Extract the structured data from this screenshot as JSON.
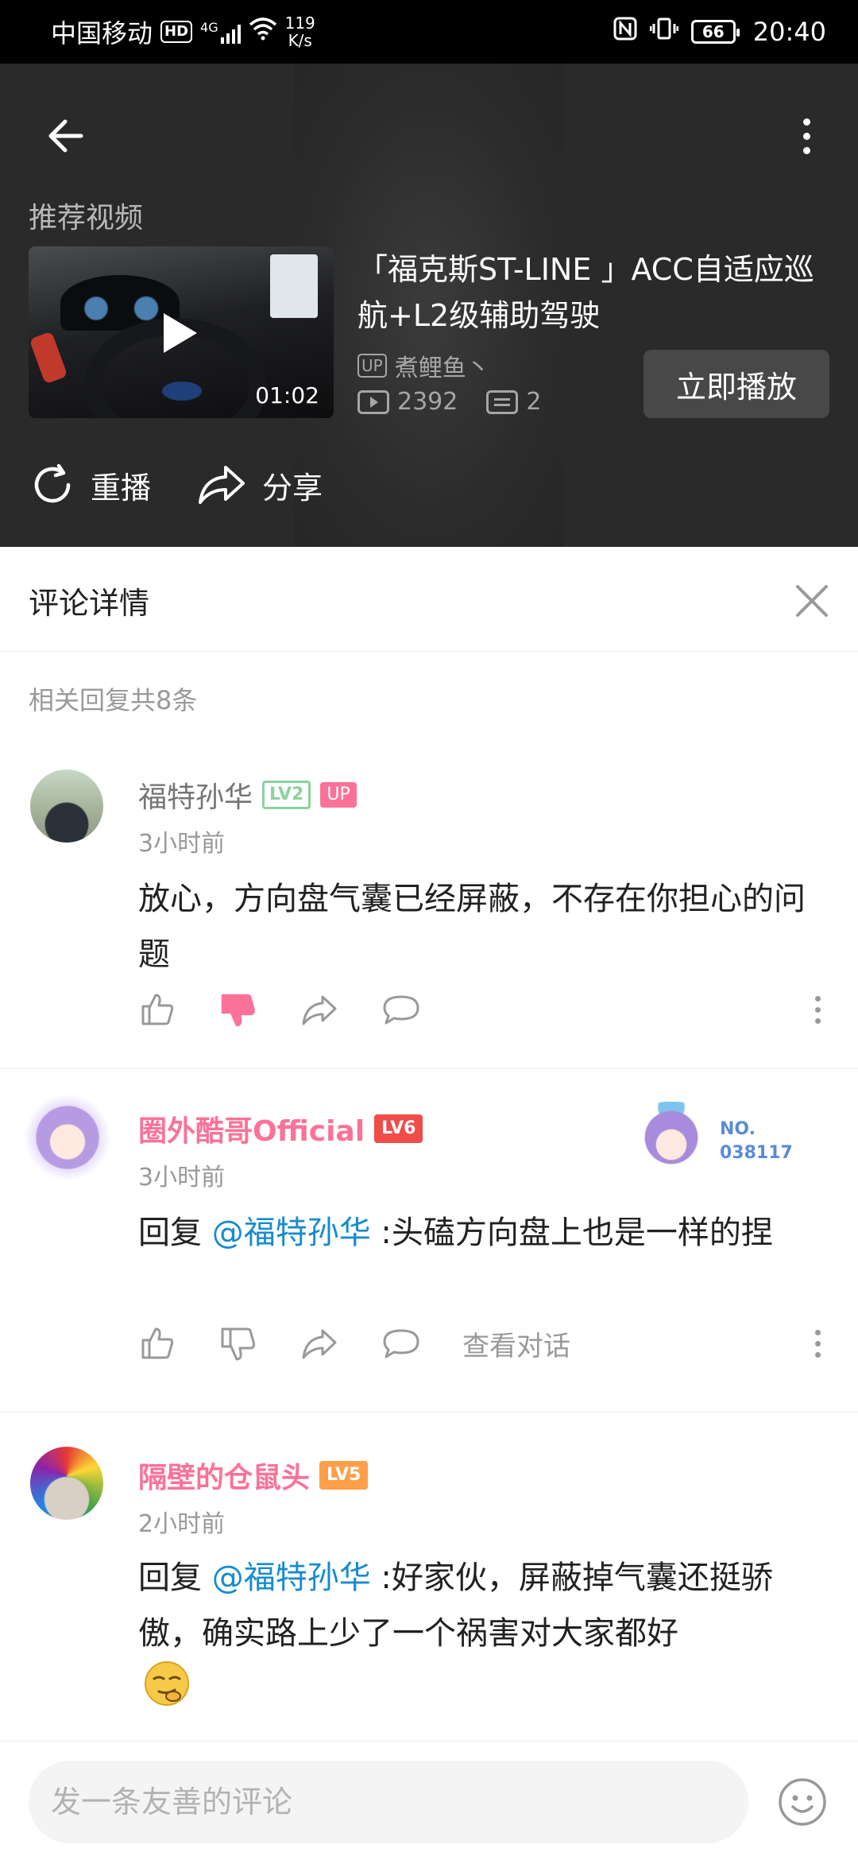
{
  "status_bar": {
    "carrier": "中国移动",
    "hd": "HD",
    "network": "4G",
    "speed_value": "119",
    "speed_unit": "K/s",
    "battery": "66",
    "time": "20:40"
  },
  "video": {
    "section_label": "推荐视频",
    "duration": "01:02",
    "title": "「福克斯ST-LINE 」ACC自适应巡航+L2级辅助驾驶",
    "up_tag": "UP",
    "uploader": "煮鲤鱼丶",
    "views": "2392",
    "comments": "2",
    "play_now": "立即播放",
    "replay": "重播",
    "share": "分享"
  },
  "comment_section": {
    "title": "评论详情",
    "reply_count": "相关回复共8条"
  },
  "comments": [
    {
      "username": "福特孙华",
      "username_color": "#757575",
      "level": "LV2",
      "up_tag": "UP",
      "time": "3小时前",
      "text": "放心，方向盘气囊已经屏蔽，不存在你担心的问题",
      "disliked": true
    },
    {
      "username": "圈外酷哥Official",
      "username_color": "#fb7299",
      "level": "LV6",
      "fan_no": "NO.",
      "fan_id": "038117",
      "time": "3小时前",
      "reply_prefix": "回复 ",
      "mention": "@福特孙华",
      "text": " :头磕方向盘上也是一样的捏",
      "view_conversation": "查看对话"
    },
    {
      "username": "隔壁的仓鼠头",
      "username_color": "#fb7299",
      "level": "LV5",
      "time": "2小时前",
      "reply_prefix": "回复 ",
      "mention": "@福特孙华",
      "text": " :好家伙，屏蔽掉气囊还挺骄傲，确实路上少了一个祸害对大家都好"
    }
  ],
  "input": {
    "placeholder": "发一条友善的评论"
  },
  "colors": {
    "accent_pink": "#fb7299",
    "mention_blue": "#178bcf",
    "header_bg": "#2a2a2a"
  }
}
